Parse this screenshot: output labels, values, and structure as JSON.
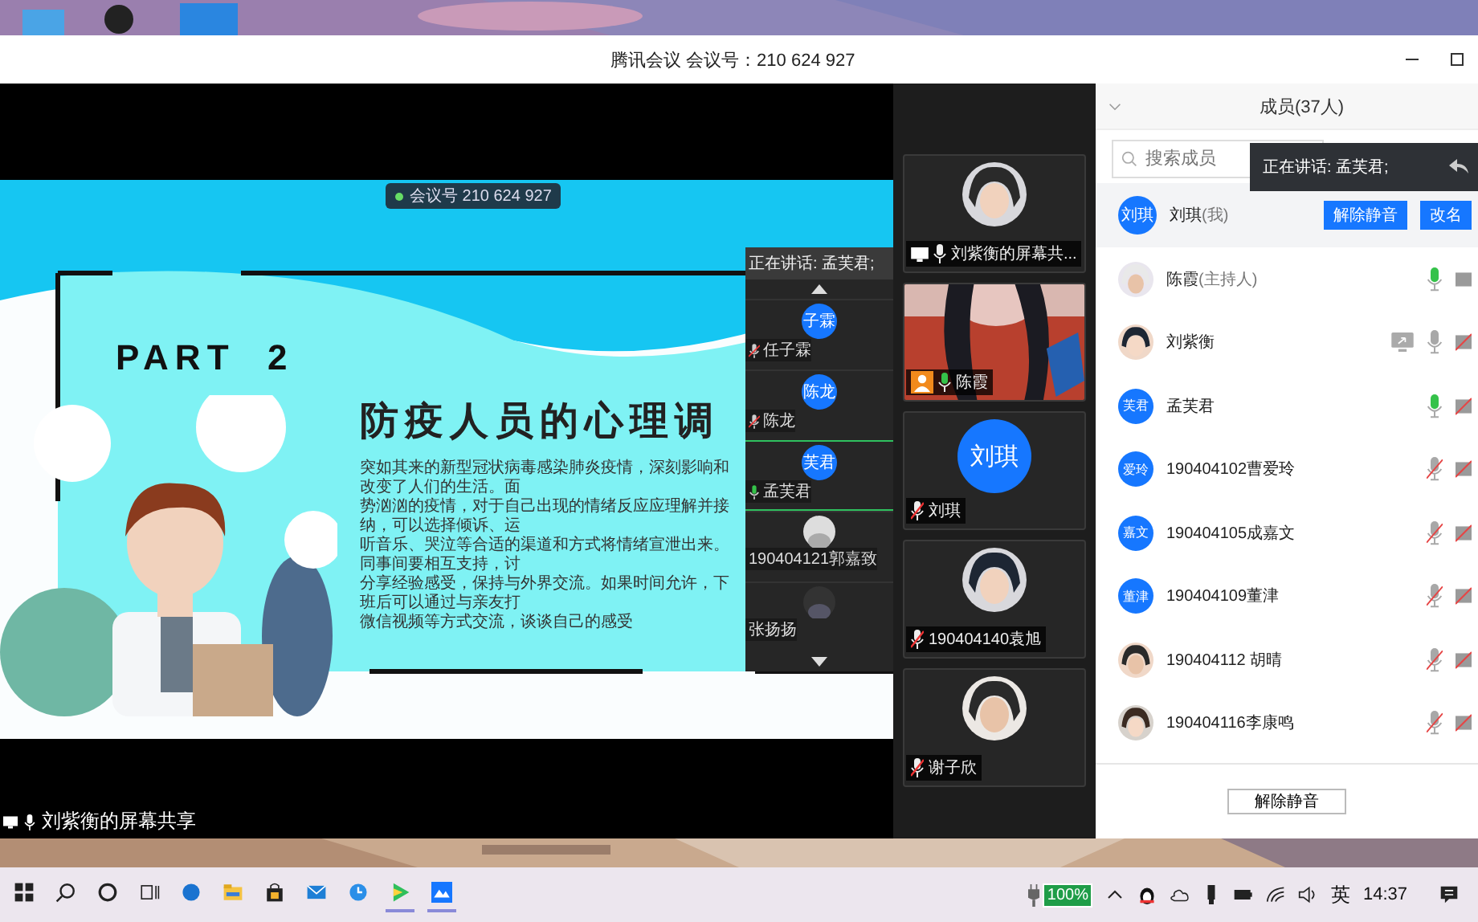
{
  "window": {
    "title": "腾讯会议 会议号：210 624 927"
  },
  "shared_screen": {
    "meeting_bar": "会议号 210 624 927",
    "slide": {
      "heading": "PART  2",
      "title": "防疫人员的心理调",
      "body": [
        "突如其来的新型冠状病毒感染肺炎疫情，深刻影响和改变了人们的生活。面",
        "势汹汹的疫情，对于自己出现的情绪反应应理解并接纳，可以选择倾诉、运",
        "听音乐、哭泣等合适的渠道和方式将情绪宣泄出来。同事间要相互支持，讨",
        "分享经验感受，保持与外界交流。如果时间允许，下班后可以通过与亲友打",
        "微信视频等方式交流，谈谈自己的感受"
      ]
    },
    "speaker_panel": {
      "speaking": "正在讲话: 孟芙君;",
      "tiles": [
        {
          "kind": "initials",
          "avatar": "子霖",
          "name": "任子霖",
          "muted": true,
          "speaking": false
        },
        {
          "kind": "initials",
          "avatar": "陈龙",
          "name": "陈龙",
          "muted": true,
          "speaking": false
        },
        {
          "kind": "initials",
          "avatar": "芙君",
          "name": "孟芙君",
          "muted": false,
          "speaking": true
        },
        {
          "kind": "picture",
          "name": "190404121郭嘉致"
        },
        {
          "kind": "picture",
          "name": "张扬扬"
        }
      ]
    },
    "caption": "刘紫衡的屏幕共享"
  },
  "video_tiles": [
    {
      "label": "刘紫衡的屏幕共...",
      "muted": false,
      "speaking": false,
      "sharing": true
    },
    {
      "kind": "video",
      "label": "陈霞",
      "muted": false,
      "speaking": true,
      "sharing": false
    },
    {
      "kind": "initials",
      "avatar": "刘琪",
      "label": "刘琪",
      "muted": true,
      "speaking": false,
      "sharing": false
    },
    {
      "label": "190404140袁旭",
      "muted": true,
      "speaking": false,
      "sharing": false
    },
    {
      "label": "谢子欣",
      "muted": true,
      "speaking": false,
      "sharing": false
    }
  ],
  "members": {
    "title": "成员(37人)",
    "search": {
      "placeholder": "搜索成员"
    },
    "speaking_tip": "正在讲话: 孟芙君;",
    "rows": [
      {
        "kind": "initials",
        "avatar": "刘琪",
        "name": "刘琪",
        "role": "(我)",
        "selected": true,
        "buttons": [
          "解除静音",
          "改名"
        ]
      },
      {
        "name": "陈霞",
        "role": "(主持人)",
        "selected": false,
        "muted": false,
        "speaking": true,
        "camera_on": true,
        "sharing": false
      },
      {
        "name": "刘紫衡",
        "selected": false,
        "muted": false,
        "speaking": false,
        "camera_on": false,
        "sharing": true
      },
      {
        "kind": "initials",
        "avatar": "芙君",
        "name": "孟芙君",
        "selected": false,
        "muted": false,
        "speaking": true,
        "camera_on": false,
        "sharing": false
      },
      {
        "kind": "initials",
        "avatar": "爱玲",
        "name": "190404102曹爱玲",
        "selected": false,
        "muted": true,
        "speaking": false,
        "camera_on": false,
        "sharing": false
      },
      {
        "kind": "initials",
        "avatar": "嘉文",
        "name": "190404105成嘉文",
        "selected": false,
        "muted": true,
        "speaking": false,
        "camera_on": false,
        "sharing": false
      },
      {
        "kind": "initials",
        "avatar": "董津",
        "name": "190404109董津",
        "selected": false,
        "muted": true,
        "speaking": false,
        "camera_on": false,
        "sharing": false
      },
      {
        "name": "190404112 胡晴",
        "selected": false,
        "muted": true,
        "speaking": false,
        "camera_on": false,
        "sharing": false
      },
      {
        "name": "190404116李康鸣",
        "selected": false,
        "muted": true,
        "speaking": false,
        "camera_on": false,
        "sharing": false
      }
    ],
    "footer_button": "解除静音"
  },
  "taskbar": {
    "apps": [
      {
        "kind": "start",
        "running": false
      },
      {
        "kind": "search",
        "running": false
      },
      {
        "kind": "cortana",
        "running": false
      },
      {
        "kind": "taskview",
        "running": false
      },
      {
        "kind": "browser",
        "running": false
      },
      {
        "kind": "folder",
        "running": false
      },
      {
        "kind": "store",
        "running": false
      },
      {
        "kind": "mail",
        "running": false
      },
      {
        "kind": "clock",
        "running": false
      },
      {
        "kind": "player",
        "running": true
      },
      {
        "kind": "meeting",
        "running": true
      }
    ],
    "battery": "100%",
    "ime": "英",
    "time": "14:37"
  }
}
